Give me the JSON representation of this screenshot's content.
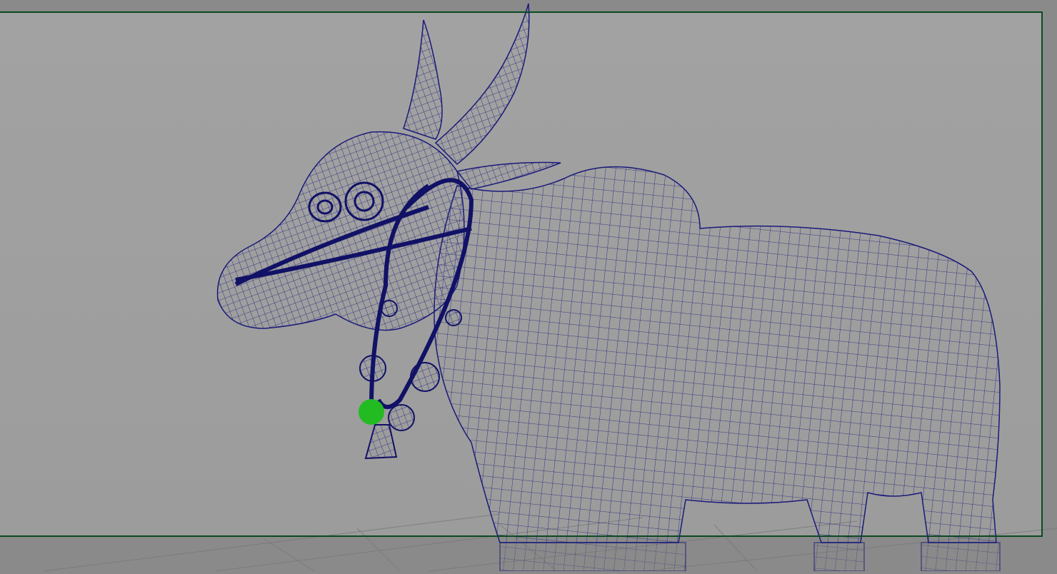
{
  "viewport": {
    "background_color": "#a0a0a0",
    "outside_gate_color": "#8a8a8a",
    "resolution_gate_color": "#0b4a22",
    "wireframe_color": "#1a1a7a",
    "accessory_color": "#111166",
    "selection_marker_color": "#22bb22",
    "grid_color": "#777777",
    "object": "bull-wireframe-model"
  }
}
